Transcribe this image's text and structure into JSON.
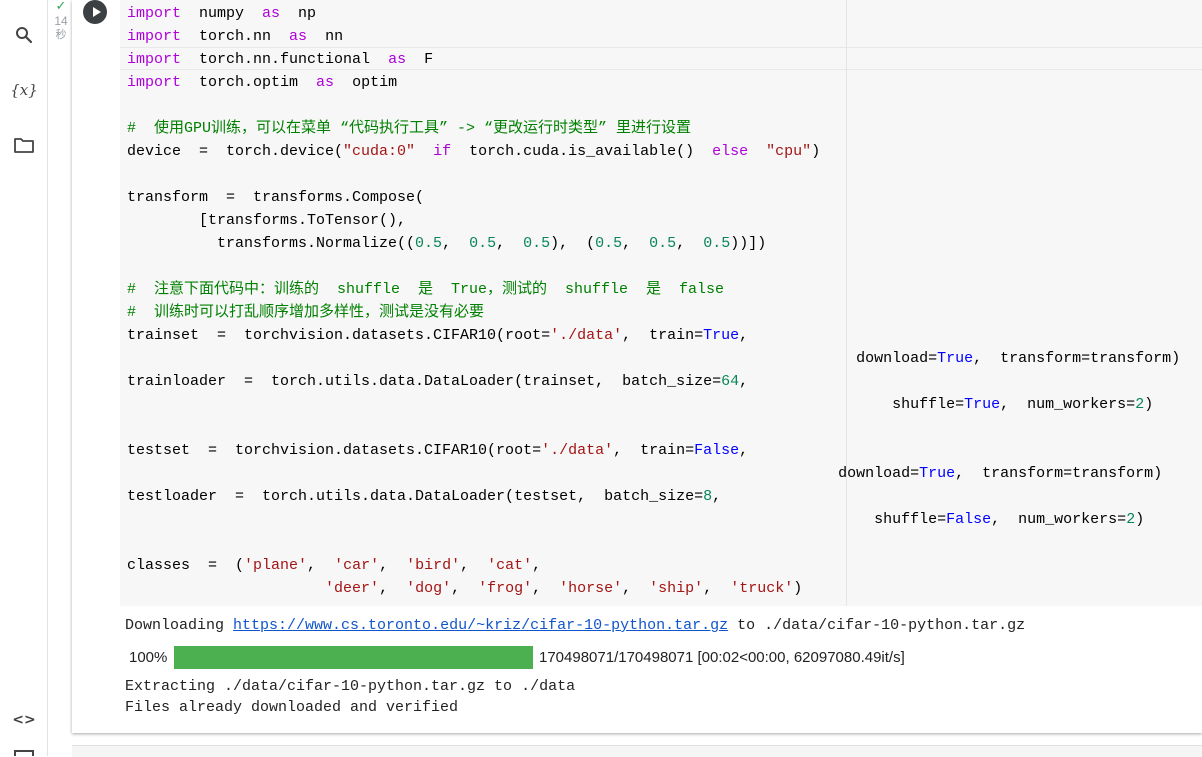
{
  "sidebar": {
    "icons": [
      "search-icon",
      "variables-icon",
      "folder-icon",
      "code-snippets-icon"
    ],
    "variables_glyph": "{x}",
    "snippets_glyph": "<>"
  },
  "cell": {
    "status_check": "✓",
    "exec_time_value": "14",
    "exec_time_unit": "秒",
    "code_lines": [
      [
        {
          "t": "kw",
          "v": "import"
        },
        {
          "t": "",
          "v": "  numpy  "
        },
        {
          "t": "kw",
          "v": "as"
        },
        {
          "t": "",
          "v": "  np"
        }
      ],
      [
        {
          "t": "kw",
          "v": "import"
        },
        {
          "t": "",
          "v": "  torch.nn  "
        },
        {
          "t": "kw",
          "v": "as"
        },
        {
          "t": "",
          "v": "  nn"
        }
      ],
      [
        {
          "t": "kw",
          "v": "import"
        },
        {
          "t": "",
          "v": "  torch.nn.functional  "
        },
        {
          "t": "kw",
          "v": "as"
        },
        {
          "t": "",
          "v": "  F"
        }
      ],
      [
        {
          "t": "kw",
          "v": "import"
        },
        {
          "t": "",
          "v": "  torch.optim  "
        },
        {
          "t": "kw",
          "v": "as"
        },
        {
          "t": "",
          "v": "  optim"
        }
      ],
      [],
      [
        {
          "t": "cm",
          "v": "#  使用GPU训练，可以在菜单 “代码执行工具” -> “更改运行时类型” 里进行设置"
        }
      ],
      [
        {
          "t": "",
          "v": "device  =  torch.device("
        },
        {
          "t": "st",
          "v": "\"cuda:0\""
        },
        {
          "t": "",
          "v": "  "
        },
        {
          "t": "kw",
          "v": "if"
        },
        {
          "t": "",
          "v": "  torch.cuda.is_available()  "
        },
        {
          "t": "kw",
          "v": "else"
        },
        {
          "t": "",
          "v": "  "
        },
        {
          "t": "st",
          "v": "\"cpu\""
        },
        {
          "t": "",
          "v": ")"
        }
      ],
      [],
      [
        {
          "t": "",
          "v": "transform  =  transforms.Compose("
        }
      ],
      [
        {
          "t": "",
          "v": "        [transforms.ToTensor(),"
        }
      ],
      [
        {
          "t": "",
          "v": "          transforms.Normalize(("
        },
        {
          "t": "nu",
          "v": "0.5"
        },
        {
          "t": "",
          "v": ",  "
        },
        {
          "t": "nu",
          "v": "0.5"
        },
        {
          "t": "",
          "v": ",  "
        },
        {
          "t": "nu",
          "v": "0.5"
        },
        {
          "t": "",
          "v": "),  ("
        },
        {
          "t": "nu",
          "v": "0.5"
        },
        {
          "t": "",
          "v": ",  "
        },
        {
          "t": "nu",
          "v": "0.5"
        },
        {
          "t": "",
          "v": ",  "
        },
        {
          "t": "nu",
          "v": "0.5"
        },
        {
          "t": "",
          "v": "))])"
        }
      ],
      [],
      [
        {
          "t": "cm",
          "v": "#  注意下面代码中：训练的  shuffle  是  True，测试的  shuffle  是  false"
        }
      ],
      [
        {
          "t": "cm",
          "v": "#  训练时可以打乱顺序增加多样性，测试是没有必要"
        }
      ],
      [
        {
          "t": "",
          "v": "trainset  =  torchvision.datasets.CIFAR10(root="
        },
        {
          "t": "st",
          "v": "'./data'"
        },
        {
          "t": "",
          "v": ",  train="
        },
        {
          "t": "bo",
          "v": "True"
        },
        {
          "t": "",
          "v": ","
        }
      ],
      [
        {
          "t": "",
          "v": "                                                                                 download="
        },
        {
          "t": "bo",
          "v": "True"
        },
        {
          "t": "",
          "v": ",  transform=transform)"
        }
      ],
      [
        {
          "t": "",
          "v": "trainloader  =  torch.utils.data.DataLoader(trainset,  batch_size="
        },
        {
          "t": "nu",
          "v": "64"
        },
        {
          "t": "",
          "v": ","
        }
      ],
      [
        {
          "t": "",
          "v": "                                                                                     shuffle="
        },
        {
          "t": "bo",
          "v": "True"
        },
        {
          "t": "",
          "v": ",  num_workers="
        },
        {
          "t": "nu",
          "v": "2"
        },
        {
          "t": "",
          "v": ")"
        }
      ],
      [],
      [
        {
          "t": "",
          "v": "testset  =  torchvision.datasets.CIFAR10(root="
        },
        {
          "t": "st",
          "v": "'./data'"
        },
        {
          "t": "",
          "v": ",  train="
        },
        {
          "t": "bo",
          "v": "False"
        },
        {
          "t": "",
          "v": ","
        }
      ],
      [
        {
          "t": "",
          "v": "                                                                               download="
        },
        {
          "t": "bo",
          "v": "True"
        },
        {
          "t": "",
          "v": ",  transform=transform)"
        }
      ],
      [
        {
          "t": "",
          "v": "testloader  =  torch.utils.data.DataLoader(testset,  batch_size="
        },
        {
          "t": "nu",
          "v": "8"
        },
        {
          "t": "",
          "v": ","
        }
      ],
      [
        {
          "t": "",
          "v": "                                                                                   shuffle="
        },
        {
          "t": "bo",
          "v": "False"
        },
        {
          "t": "",
          "v": ",  num_workers="
        },
        {
          "t": "nu",
          "v": "2"
        },
        {
          "t": "",
          "v": ")"
        }
      ],
      [],
      [
        {
          "t": "",
          "v": "classes  =  ("
        },
        {
          "t": "st",
          "v": "'plane'"
        },
        {
          "t": "",
          "v": ",  "
        },
        {
          "t": "st",
          "v": "'car'"
        },
        {
          "t": "",
          "v": ",  "
        },
        {
          "t": "st",
          "v": "'bird'"
        },
        {
          "t": "",
          "v": ",  "
        },
        {
          "t": "st",
          "v": "'cat'"
        },
        {
          "t": "",
          "v": ","
        }
      ],
      [
        {
          "t": "",
          "v": "                      "
        },
        {
          "t": "st",
          "v": "'deer'"
        },
        {
          "t": "",
          "v": ",  "
        },
        {
          "t": "st",
          "v": "'dog'"
        },
        {
          "t": "",
          "v": ",  "
        },
        {
          "t": "st",
          "v": "'frog'"
        },
        {
          "t": "",
          "v": ",  "
        },
        {
          "t": "st",
          "v": "'horse'"
        },
        {
          "t": "",
          "v": ",  "
        },
        {
          "t": "st",
          "v": "'ship'"
        },
        {
          "t": "",
          "v": ",  "
        },
        {
          "t": "st",
          "v": "'truck'"
        },
        {
          "t": "",
          "v": ")"
        }
      ]
    ]
  },
  "output": {
    "download_prefix": "Downloading ",
    "download_url": "https://www.cs.toronto.edu/~kriz/cifar-10-python.tar.gz",
    "download_suffix": " to ./data/cifar-10-python.tar.gz",
    "progress_percent_label": "100%",
    "progress_fraction": 1.0,
    "progress_stats": "170498071/170498071 [00:02<00:00, 62097080.49it/s]",
    "extract_line": "Extracting ./data/cifar-10-python.tar.gz to ./data",
    "verified_line": "Files already downloaded and verified"
  },
  "colors": {
    "keyword": "#af00db",
    "comment": "#008000",
    "string": "#a31515",
    "number": "#098658",
    "boolean": "#0000ff",
    "progress_fill": "#4caf50",
    "status_check": "#34a853"
  }
}
